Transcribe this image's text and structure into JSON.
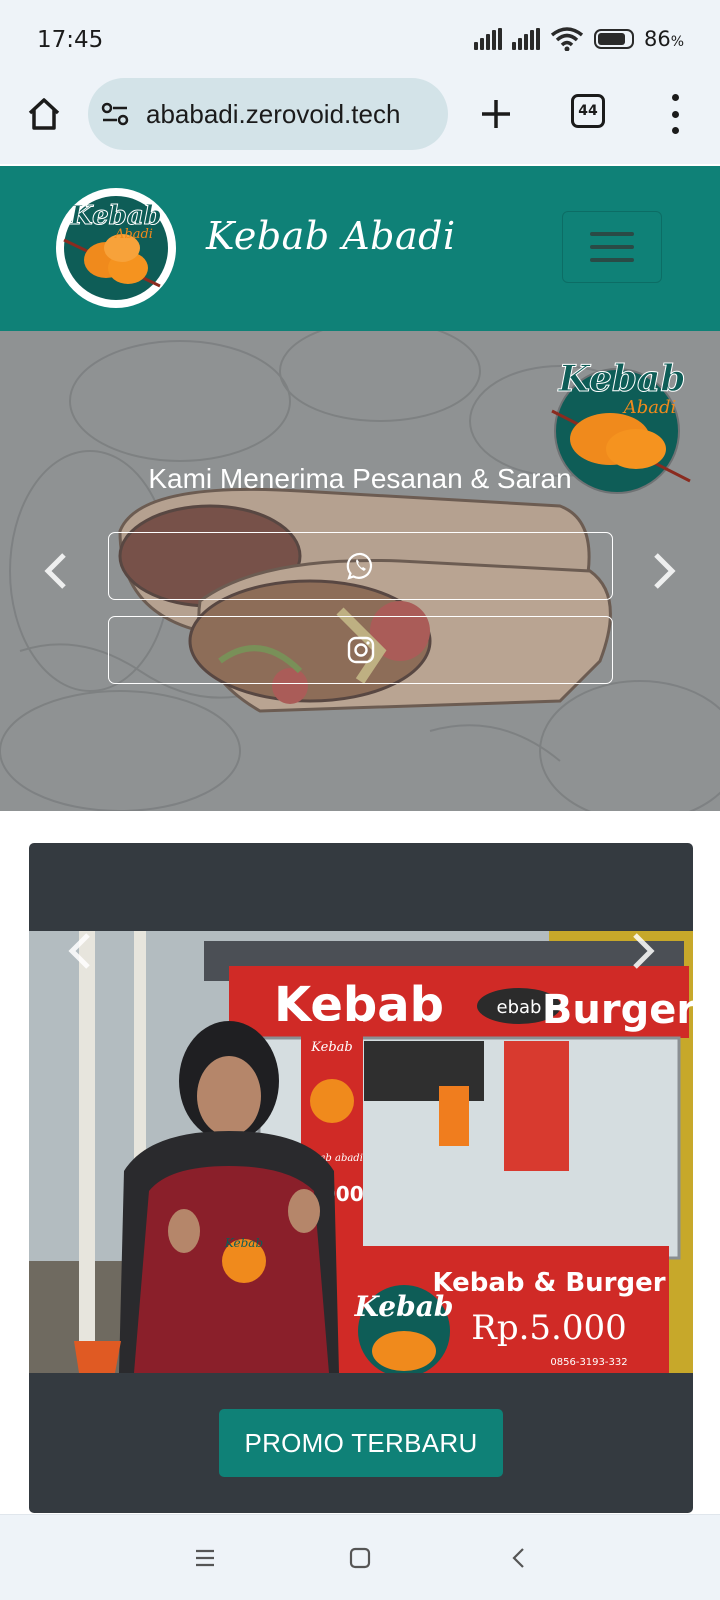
{
  "status_bar": {
    "time": "17:45",
    "battery_level": "86",
    "battery_unit": "%",
    "battery_fraction": 0.86
  },
  "browser": {
    "url": "ababadi.zerovoid.tech",
    "tab_count": "44",
    "icons": [
      "home-icon",
      "site-settings-icon",
      "new-tab-plus-icon",
      "tabs-icon",
      "overflow-menu-icon"
    ]
  },
  "header": {
    "brand_name": "Kebab Abadi",
    "logo_text_main": "Kebab",
    "logo_text_sub": "Abadi",
    "background_color": "#0f8177"
  },
  "hero": {
    "title": "Kami Menerima Pesanan & Saran",
    "buttons": [
      {
        "icon": "whatsapp-icon"
      },
      {
        "icon": "instagram-icon"
      }
    ],
    "logo_text_main": "Kebab",
    "logo_text_sub": "Abadi"
  },
  "promo": {
    "button_label": "PROMO TERBARU",
    "photo_signs": {
      "banner_left": "Kebab",
      "banner_right": "Burger",
      "banner_logo": "ebab",
      "front_title": "Kebab & Burger",
      "front_price": "Rp.5.000",
      "front_logo": "Kebab",
      "side_logo": "Kebab",
      "side_name": "kebab abadi",
      "side_price": "5.000",
      "apron_logo": "Kebab",
      "phone": "0856-3193-332"
    },
    "slides_total": 2,
    "active_slide": 1,
    "accent_color": "#0f8177"
  },
  "nav_bar": {
    "icons": [
      "recent-apps-icon",
      "home-circle-icon",
      "back-icon"
    ]
  }
}
